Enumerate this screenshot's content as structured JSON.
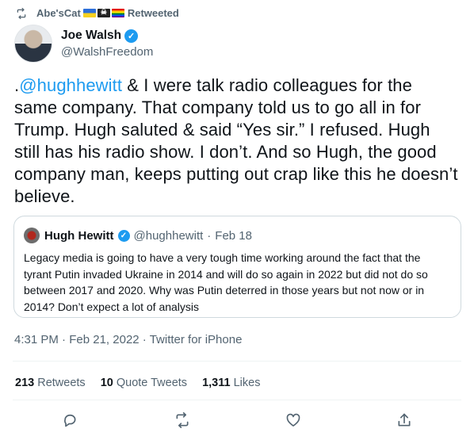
{
  "retweet": {
    "user": "Abe'sCat",
    "label": "Retweeted"
  },
  "author": {
    "name": "Joe Walsh",
    "handle": "@WalshFreedom"
  },
  "tweet": {
    "prefix": ".",
    "mention": "@hughhewitt",
    "text": " & I were talk radio colleagues for the same company. That company told us to go all in for Trump. Hugh saluted & said “Yes sir.” I refused. Hugh still has his radio show. I don’t. And so Hugh, the good company man, keeps putting out crap like this he doesn’t believe."
  },
  "quote": {
    "name": "Hugh Hewitt",
    "handle": "@hughhewitt",
    "sep": "·",
    "date": "Feb 18",
    "text": "Legacy media is going to have a very tough time working around the fact that the tyrant Putin invaded Ukraine in 2014 and will do so again in 2022 but did not do so between 2017 and 2020. Why was Putin deterred in those years but not now or in 2014? Don’t expect a lot of analysis"
  },
  "meta": {
    "time": "4:31 PM",
    "date": "Feb 21, 2022",
    "source": "Twitter for iPhone",
    "sep": "·"
  },
  "stats": {
    "retweets_count": "213",
    "retweets_label": "Retweets",
    "quotes_count": "10",
    "quotes_label": "Quote Tweets",
    "likes_count": "1,311",
    "likes_label": "Likes"
  },
  "icons": {
    "retweet": "retweet-icon",
    "reply": "reply-icon",
    "like": "heart-icon",
    "share": "share-icon",
    "verified": "verified-badge-icon"
  },
  "colors": {
    "accent": "#1d9bf0",
    "secondary_text": "#536471",
    "border": "#cfd9de"
  }
}
